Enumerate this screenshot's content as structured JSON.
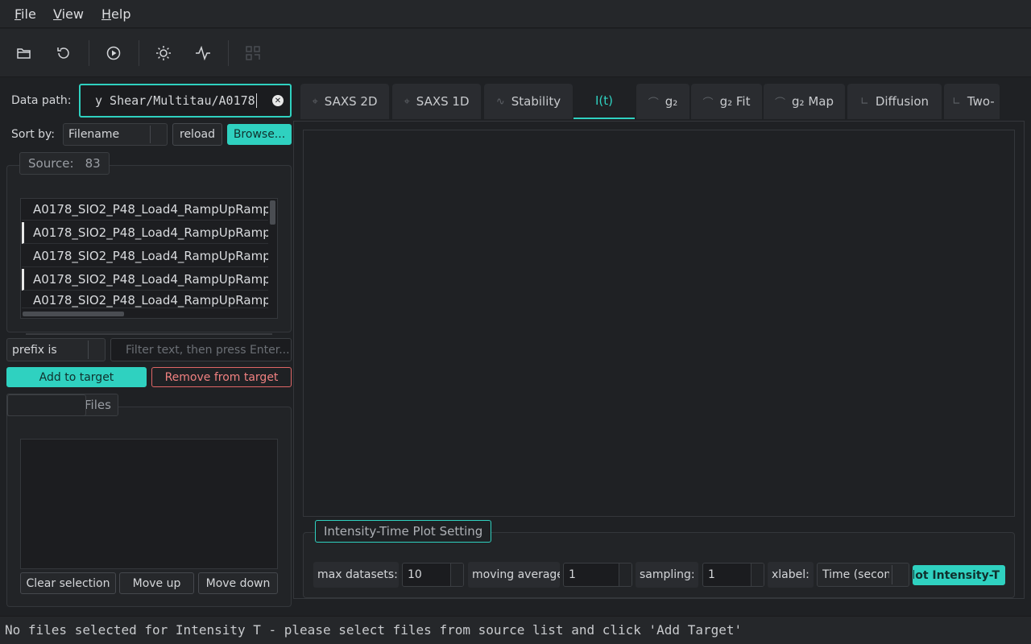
{
  "menu": {
    "file": "File",
    "file_u": "F",
    "file_rest": "ile",
    "view_u": "V",
    "view_rest": "iew",
    "help_u": "H",
    "help_rest": "elp"
  },
  "toolbar": {
    "icons": [
      "folder-open-icon",
      "refresh-icon",
      "play-icon",
      "sun-icon",
      "pulse-icon",
      "grid-icon"
    ]
  },
  "left": {
    "data_path_label": "Data path:",
    "data_path_value": "y Shear/Multitau/A0178",
    "sort_label": "Sort by:",
    "sort_value": "Filename",
    "reload": "reload",
    "browse": "Browse...",
    "source_title": "Source:",
    "source_count": "83",
    "files": [
      "A0178_SIO2_P48_Load4_RampUpRamp",
      "A0178_SIO2_P48_Load4_RampUpRamp",
      "A0178_SIO2_P48_Load4_RampUpRamp",
      "A0178_SIO2_P48_Load4_RampUpRamp",
      "A0178_SIO2_P48_Load4_RampUpRamp"
    ],
    "filter_mode": "prefix is",
    "filter_placeholder": "Filter text, then press Enter...",
    "add_target": "Add to target",
    "remove_target": "Remove from target",
    "target_title": "Files",
    "clear_selection": "Clear selection",
    "move_up": "Move up",
    "move_down": "Move down"
  },
  "tabs": [
    {
      "label": "SAXS 2D",
      "icon": "crosshair-icon"
    },
    {
      "label": "SAXS 1D",
      "icon": "crosshair-icon"
    },
    {
      "label": "Stability",
      "icon": "pulse-icon"
    },
    {
      "label": "I(t)",
      "icon": ""
    },
    {
      "label": "g₂",
      "icon": "curve-icon"
    },
    {
      "label": "g₂ Fit",
      "icon": "curve-icon"
    },
    {
      "label": "g₂ Map",
      "icon": "curve-icon"
    },
    {
      "label": "Diffusion",
      "icon": "axes-icon"
    },
    {
      "label": "Two-",
      "icon": "axes-icon"
    }
  ],
  "plot_setting": {
    "title": "Intensity-Time Plot Setting",
    "max_datasets_label": "max datasets:",
    "max_datasets_value": "10",
    "moving_average_label": "moving average",
    "moving_average_value": "1",
    "sampling_label": "sampling:",
    "sampling_value": "1",
    "xlabel_label": "xlabel:",
    "xlabel_value": "Time (seconds)",
    "plot_button": "plot Intensity-T"
  },
  "status": "No files selected for Intensity T - please select files from source list and click 'Add Target'",
  "colors": {
    "accent": "#2fd1c0",
    "danger": "#e06666",
    "background": "#1f2124"
  }
}
